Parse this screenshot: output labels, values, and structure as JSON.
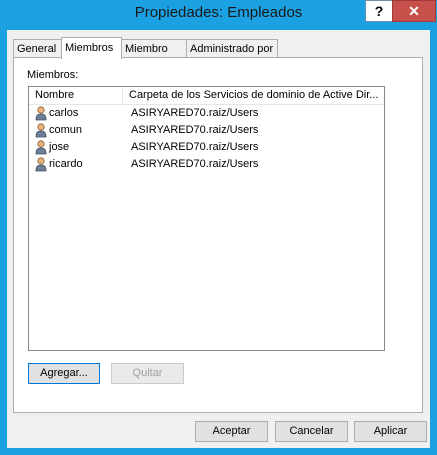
{
  "window": {
    "title": "Propiedades: Empleados",
    "help_label": "?",
    "close_label": "✕"
  },
  "tabs": [
    {
      "label": "General"
    },
    {
      "label": "Miembros"
    },
    {
      "label": "Miembro de"
    },
    {
      "label": "Administrado por"
    }
  ],
  "members": {
    "label": "Miembros:",
    "columns": [
      "Nombre",
      "Carpeta de los Servicios de dominio de Active Dir..."
    ],
    "rows": [
      {
        "name": "carlos",
        "folder": "ASIRYARED70.raiz/Users"
      },
      {
        "name": "comun",
        "folder": "ASIRYARED70.raiz/Users"
      },
      {
        "name": "jose",
        "folder": "ASIRYARED70.raiz/Users"
      },
      {
        "name": "ricardo",
        "folder": "ASIRYARED70.raiz/Users"
      }
    ],
    "add_label": "Agregar...",
    "remove_label": "Quitar"
  },
  "footer": {
    "ok_label": "Aceptar",
    "cancel_label": "Cancelar",
    "apply_label": "Aplicar"
  },
  "icons": {
    "user": "user-icon"
  },
  "colors": {
    "titlebar": "#1ba0e1",
    "close": "#c7504b",
    "focus_border": "#0078d7"
  }
}
